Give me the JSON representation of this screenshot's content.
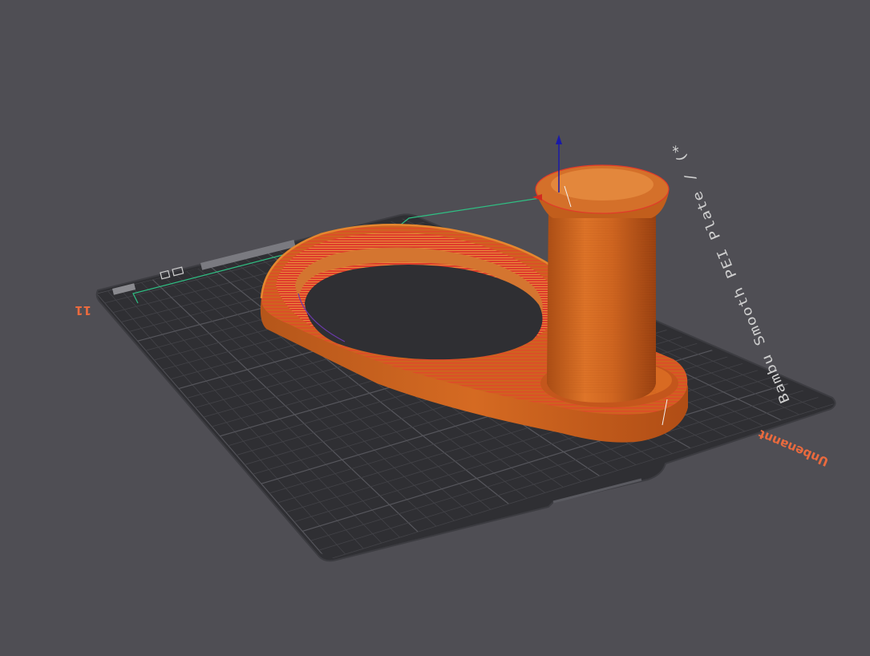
{
  "plate": {
    "number": "11",
    "name": "Unbenannt",
    "type_text": "Bambu Smooth PEI Plate / (*",
    "colors": {
      "background": "#4f4e54",
      "plate": "#2f2f33",
      "grid": "#47474c",
      "origin_marker": "#2fbf83"
    }
  },
  "model": {
    "colors": {
      "orange": "#d2661c",
      "orange_light": "#e98a3a",
      "orange_dark": "#9e4612",
      "red_layer": "#dd3a2a"
    }
  },
  "gizmo": {
    "z_axis_color": "#1a1aa8",
    "x_axis_color": "#d22a20"
  }
}
